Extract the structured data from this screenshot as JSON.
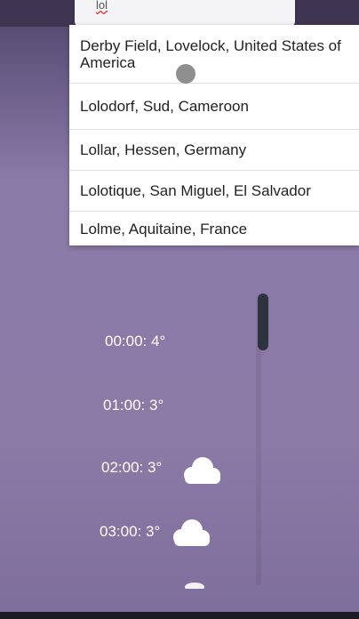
{
  "search": {
    "query": "lol"
  },
  "suggestions": [
    {
      "label": "Derby Field, Lovelock, United States of America"
    },
    {
      "label": "Lolodorf, Sud, Cameroon"
    },
    {
      "label": "Lollar, Hessen, Germany"
    },
    {
      "label": "Lolotique, San Miguel, El Salvador"
    },
    {
      "label": "Lolme, Aquitaine, France"
    }
  ],
  "forecast": [
    {
      "time": "00:00",
      "temp": "4°",
      "label": "00:00: 4°",
      "icon": "moon-icon"
    },
    {
      "time": "01:00",
      "temp": "3°",
      "label": "01:00: 3°",
      "icon": "moon-icon"
    },
    {
      "time": "02:00",
      "temp": "3°",
      "label": "02:00: 3°",
      "icon": "moon-cloud-icon"
    },
    {
      "time": "03:00",
      "temp": "3°",
      "label": "03:00: 3°",
      "icon": "cloud-icon"
    }
  ],
  "colors": {
    "background": "#8b7aa6",
    "moon": "#2b3a8f",
    "cloud": "#ffffff",
    "scroll_thumb": "#2e3340"
  }
}
